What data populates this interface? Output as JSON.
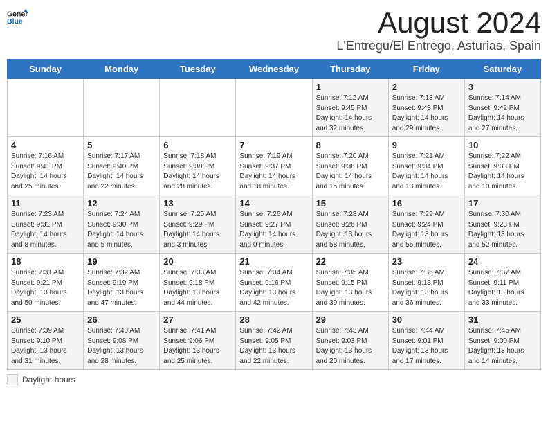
{
  "header": {
    "logo_general": "General",
    "logo_blue": "Blue",
    "month_year": "August 2024",
    "location": "L'Entregu/El Entrego, Asturias, Spain"
  },
  "weekdays": [
    "Sunday",
    "Monday",
    "Tuesday",
    "Wednesday",
    "Thursday",
    "Friday",
    "Saturday"
  ],
  "legend": {
    "label": "Daylight hours"
  },
  "weeks": [
    [
      {
        "day": "",
        "info": ""
      },
      {
        "day": "",
        "info": ""
      },
      {
        "day": "",
        "info": ""
      },
      {
        "day": "",
        "info": ""
      },
      {
        "day": "1",
        "info": "Sunrise: 7:12 AM\nSunset: 9:45 PM\nDaylight: 14 hours\nand 32 minutes."
      },
      {
        "day": "2",
        "info": "Sunrise: 7:13 AM\nSunset: 9:43 PM\nDaylight: 14 hours\nand 29 minutes."
      },
      {
        "day": "3",
        "info": "Sunrise: 7:14 AM\nSunset: 9:42 PM\nDaylight: 14 hours\nand 27 minutes."
      }
    ],
    [
      {
        "day": "4",
        "info": "Sunrise: 7:16 AM\nSunset: 9:41 PM\nDaylight: 14 hours\nand 25 minutes."
      },
      {
        "day": "5",
        "info": "Sunrise: 7:17 AM\nSunset: 9:40 PM\nDaylight: 14 hours\nand 22 minutes."
      },
      {
        "day": "6",
        "info": "Sunrise: 7:18 AM\nSunset: 9:38 PM\nDaylight: 14 hours\nand 20 minutes."
      },
      {
        "day": "7",
        "info": "Sunrise: 7:19 AM\nSunset: 9:37 PM\nDaylight: 14 hours\nand 18 minutes."
      },
      {
        "day": "8",
        "info": "Sunrise: 7:20 AM\nSunset: 9:36 PM\nDaylight: 14 hours\nand 15 minutes."
      },
      {
        "day": "9",
        "info": "Sunrise: 7:21 AM\nSunset: 9:34 PM\nDaylight: 14 hours\nand 13 minutes."
      },
      {
        "day": "10",
        "info": "Sunrise: 7:22 AM\nSunset: 9:33 PM\nDaylight: 14 hours\nand 10 minutes."
      }
    ],
    [
      {
        "day": "11",
        "info": "Sunrise: 7:23 AM\nSunset: 9:31 PM\nDaylight: 14 hours\nand 8 minutes."
      },
      {
        "day": "12",
        "info": "Sunrise: 7:24 AM\nSunset: 9:30 PM\nDaylight: 14 hours\nand 5 minutes."
      },
      {
        "day": "13",
        "info": "Sunrise: 7:25 AM\nSunset: 9:29 PM\nDaylight: 14 hours\nand 3 minutes."
      },
      {
        "day": "14",
        "info": "Sunrise: 7:26 AM\nSunset: 9:27 PM\nDaylight: 14 hours\nand 0 minutes."
      },
      {
        "day": "15",
        "info": "Sunrise: 7:28 AM\nSunset: 9:26 PM\nDaylight: 13 hours\nand 58 minutes."
      },
      {
        "day": "16",
        "info": "Sunrise: 7:29 AM\nSunset: 9:24 PM\nDaylight: 13 hours\nand 55 minutes."
      },
      {
        "day": "17",
        "info": "Sunrise: 7:30 AM\nSunset: 9:23 PM\nDaylight: 13 hours\nand 52 minutes."
      }
    ],
    [
      {
        "day": "18",
        "info": "Sunrise: 7:31 AM\nSunset: 9:21 PM\nDaylight: 13 hours\nand 50 minutes."
      },
      {
        "day": "19",
        "info": "Sunrise: 7:32 AM\nSunset: 9:19 PM\nDaylight: 13 hours\nand 47 minutes."
      },
      {
        "day": "20",
        "info": "Sunrise: 7:33 AM\nSunset: 9:18 PM\nDaylight: 13 hours\nand 44 minutes."
      },
      {
        "day": "21",
        "info": "Sunrise: 7:34 AM\nSunset: 9:16 PM\nDaylight: 13 hours\nand 42 minutes."
      },
      {
        "day": "22",
        "info": "Sunrise: 7:35 AM\nSunset: 9:15 PM\nDaylight: 13 hours\nand 39 minutes."
      },
      {
        "day": "23",
        "info": "Sunrise: 7:36 AM\nSunset: 9:13 PM\nDaylight: 13 hours\nand 36 minutes."
      },
      {
        "day": "24",
        "info": "Sunrise: 7:37 AM\nSunset: 9:11 PM\nDaylight: 13 hours\nand 33 minutes."
      }
    ],
    [
      {
        "day": "25",
        "info": "Sunrise: 7:39 AM\nSunset: 9:10 PM\nDaylight: 13 hours\nand 31 minutes."
      },
      {
        "day": "26",
        "info": "Sunrise: 7:40 AM\nSunset: 9:08 PM\nDaylight: 13 hours\nand 28 minutes."
      },
      {
        "day": "27",
        "info": "Sunrise: 7:41 AM\nSunset: 9:06 PM\nDaylight: 13 hours\nand 25 minutes."
      },
      {
        "day": "28",
        "info": "Sunrise: 7:42 AM\nSunset: 9:05 PM\nDaylight: 13 hours\nand 22 minutes."
      },
      {
        "day": "29",
        "info": "Sunrise: 7:43 AM\nSunset: 9:03 PM\nDaylight: 13 hours\nand 20 minutes."
      },
      {
        "day": "30",
        "info": "Sunrise: 7:44 AM\nSunset: 9:01 PM\nDaylight: 13 hours\nand 17 minutes."
      },
      {
        "day": "31",
        "info": "Sunrise: 7:45 AM\nSunset: 9:00 PM\nDaylight: 13 hours\nand 14 minutes."
      }
    ]
  ]
}
